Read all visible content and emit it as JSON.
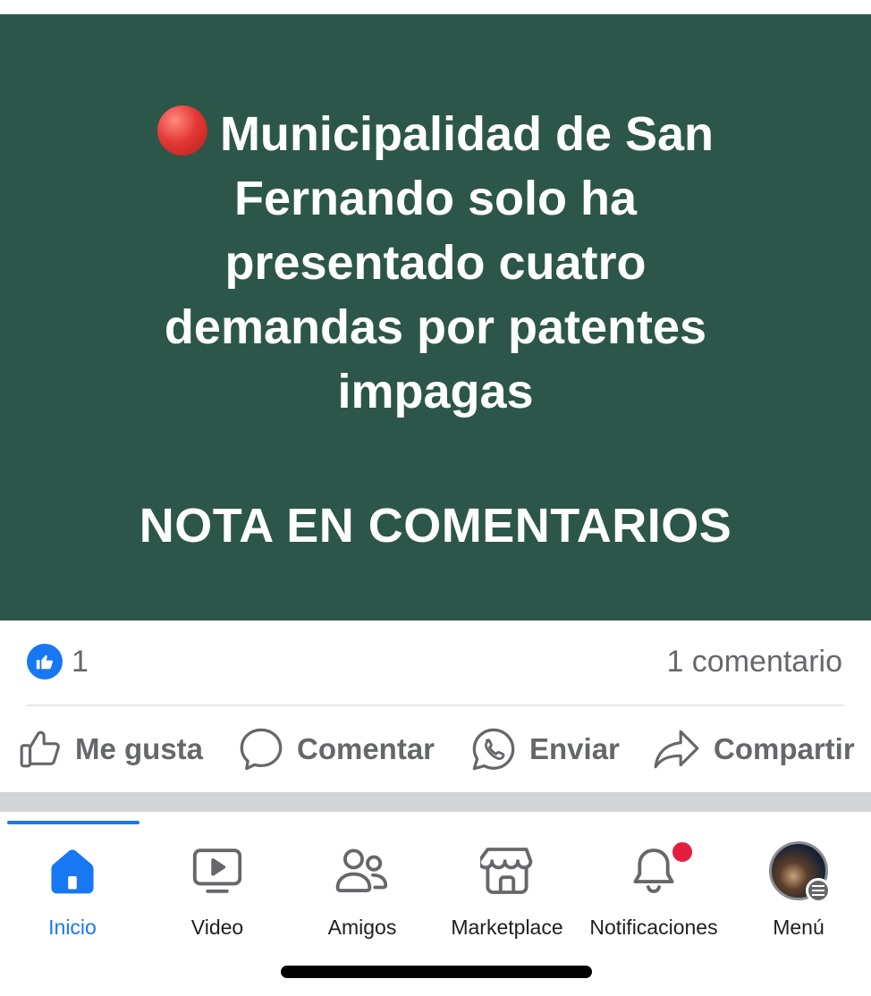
{
  "post": {
    "headline": "Municipalidad de San Fernando solo ha presentado cuatro demandas por patentes impagas",
    "note": "NOTA EN COMENTARIOS",
    "background_color": "#2c5649"
  },
  "stats": {
    "like_count": "1",
    "comment_count": "1 comentario"
  },
  "actions": {
    "like": "Me gusta",
    "comment": "Comentar",
    "send": "Enviar",
    "share": "Compartir"
  },
  "nav": {
    "home": "Inicio",
    "video": "Video",
    "friends": "Amigos",
    "marketplace": "Marketplace",
    "notifications": "Notificaciones",
    "menu": "Menú",
    "active": "home"
  },
  "colors": {
    "accent": "#1877f2",
    "notification_dot": "#e41e3f"
  }
}
